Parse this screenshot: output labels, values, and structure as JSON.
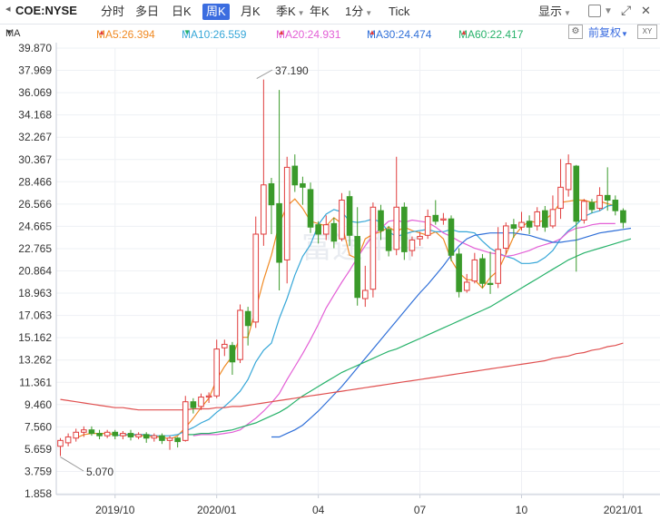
{
  "toolbar": {
    "symbol": "COE:NYSE",
    "timeframes": [
      {
        "label": "分时",
        "active": false,
        "caret": false
      },
      {
        "label": "多日",
        "active": false,
        "caret": false
      },
      {
        "label": "日K",
        "active": false,
        "caret": false
      },
      {
        "label": "周K",
        "active": true,
        "caret": false
      },
      {
        "label": "月K",
        "active": false,
        "caret": false
      },
      {
        "label": "季K",
        "active": false,
        "caret": true
      },
      {
        "label": "年K",
        "active": false,
        "caret": false
      },
      {
        "label": "1分",
        "active": false,
        "caret": true
      },
      {
        "label": "Tick",
        "active": false,
        "caret": false
      }
    ],
    "display_label": "显示",
    "adjust_label": "前复权",
    "ma_label": "MA"
  },
  "ma_indicators": [
    {
      "label": "MA5:26.394",
      "color": "#f08a24",
      "trend": "▲"
    },
    {
      "label": "MA10:26.559",
      "color": "#37a7d8",
      "trend": "▼"
    },
    {
      "label": "MA20:24.931",
      "color": "#e35fd6",
      "trend": "▲"
    },
    {
      "label": "MA30:24.474",
      "color": "#2f6fd8",
      "trend": "▲"
    },
    {
      "label": "MA60:22.417",
      "color": "#27b26a",
      "trend": "▲"
    }
  ],
  "colors": {
    "up": "#e03c3c",
    "down": "#3a9a2a",
    "ma120": "#e05050"
  },
  "chart_data": {
    "type": "candlestick",
    "y_ticks": [
      "39.870",
      "37.969",
      "36.069",
      "34.168",
      "32.267",
      "30.367",
      "28.466",
      "26.566",
      "24.665",
      "22.765",
      "20.864",
      "18.963",
      "17.063",
      "15.162",
      "13.262",
      "11.361",
      "9.460",
      "7.560",
      "5.659",
      "3.759",
      "1.858"
    ],
    "ylim": [
      1.858,
      39.87
    ],
    "x_labels": [
      {
        "label": "2019/10",
        "i": 7
      },
      {
        "label": "2020/01",
        "i": 20
      },
      {
        "label": "04",
        "i": 33
      },
      {
        "label": "07",
        "i": 46
      },
      {
        "label": "10",
        "i": 59
      },
      {
        "label": "2021/01",
        "i": 72
      }
    ],
    "annotations": [
      {
        "label": "37.190",
        "i": 25,
        "value": 37.19
      },
      {
        "label": "5.070",
        "i": 0,
        "value": 5.07
      }
    ],
    "candles": [
      [
        5.9,
        6.4,
        5.07,
        6.6
      ],
      [
        6.2,
        6.7,
        5.9,
        7.0
      ],
      [
        6.6,
        7.1,
        6.3,
        7.4
      ],
      [
        7.1,
        7.3,
        6.7,
        7.6
      ],
      [
        7.3,
        7.0,
        6.8,
        7.6
      ],
      [
        7.0,
        6.8,
        6.5,
        7.3
      ],
      [
        6.8,
        7.1,
        6.6,
        7.3
      ],
      [
        7.1,
        6.8,
        6.5,
        7.3
      ],
      [
        6.8,
        7.0,
        6.5,
        7.2
      ],
      [
        7.0,
        6.7,
        6.4,
        7.3
      ],
      [
        6.7,
        6.9,
        6.5,
        7.1
      ],
      [
        6.9,
        6.6,
        6.2,
        7.1
      ],
      [
        6.6,
        6.8,
        6.3,
        7.0
      ],
      [
        6.8,
        6.4,
        6.1,
        7.0
      ],
      [
        6.4,
        6.6,
        5.6,
        6.8
      ],
      [
        6.6,
        6.3,
        5.8,
        6.7
      ],
      [
        6.4,
        9.7,
        6.3,
        10.2
      ],
      [
        9.7,
        9.2,
        8.7,
        10.0
      ],
      [
        9.3,
        10.1,
        9.0,
        10.4
      ],
      [
        10.1,
        10.2,
        9.6,
        10.5
      ],
      [
        10.2,
        14.2,
        10.0,
        15.0
      ],
      [
        14.3,
        14.6,
        13.6,
        15.0
      ],
      [
        14.5,
        13.1,
        12.0,
        14.8
      ],
      [
        13.3,
        17.5,
        13.0,
        18.0
      ],
      [
        17.4,
        16.2,
        14.5,
        17.8
      ],
      [
        16.5,
        24.0,
        16.0,
        25.5
      ],
      [
        24.0,
        28.2,
        23.0,
        37.19
      ],
      [
        28.3,
        26.5,
        24.0,
        28.8
      ],
      [
        26.6,
        21.6,
        19.2,
        36.3
      ],
      [
        21.8,
        29.7,
        19.8,
        30.6
      ],
      [
        29.8,
        28.2,
        27.6,
        30.8
      ],
      [
        28.3,
        28.0,
        26.5,
        28.9
      ],
      [
        27.8,
        24.6,
        24.1,
        28.4
      ],
      [
        24.8,
        24.0,
        23.2,
        25.1
      ],
      [
        24.0,
        24.8,
        23.5,
        25.6
      ],
      [
        24.9,
        23.4,
        22.8,
        25.4
      ],
      [
        23.6,
        26.9,
        23.4,
        27.5
      ],
      [
        27.2,
        23.9,
        23.0,
        27.7
      ],
      [
        23.8,
        18.6,
        17.9,
        26.3
      ],
      [
        18.5,
        19.2,
        17.8,
        21.3
      ],
      [
        19.3,
        26.3,
        18.6,
        26.7
      ],
      [
        26.0,
        24.3,
        23.5,
        26.5
      ],
      [
        24.4,
        22.6,
        22.1,
        24.7
      ],
      [
        22.7,
        26.3,
        22.2,
        30.6
      ],
      [
        26.3,
        22.5,
        21.8,
        26.7
      ],
      [
        22.6,
        23.5,
        22.1,
        23.8
      ],
      [
        23.6,
        23.8,
        23.0,
        24.2
      ],
      [
        23.9,
        25.5,
        23.6,
        26.1
      ],
      [
        25.6,
        25.1,
        24.8,
        26.9
      ],
      [
        25.2,
        25.3,
        24.8,
        25.8
      ],
      [
        25.3,
        22.2,
        21.7,
        25.6
      ],
      [
        22.3,
        19.1,
        18.6,
        22.8
      ],
      [
        19.2,
        19.9,
        19.0,
        20.6
      ],
      [
        20.0,
        21.8,
        19.8,
        22.4
      ],
      [
        21.9,
        19.8,
        19.4,
        22.3
      ],
      [
        19.8,
        19.7,
        18.9,
        22.5
      ],
      [
        19.8,
        22.7,
        19.4,
        24.6
      ],
      [
        22.8,
        24.7,
        22.3,
        25.0
      ],
      [
        24.8,
        24.5,
        23.7,
        25.3
      ],
      [
        24.6,
        25.0,
        24.3,
        25.9
      ],
      [
        25.1,
        24.6,
        24.0,
        25.6
      ],
      [
        24.7,
        25.9,
        24.3,
        26.3
      ],
      [
        26.0,
        24.6,
        24.2,
        26.4
      ],
      [
        24.7,
        26.1,
        24.5,
        27.3
      ],
      [
        26.2,
        28.0,
        25.3,
        30.4
      ],
      [
        27.8,
        30.0,
        27.2,
        30.8
      ],
      [
        29.8,
        25.1,
        20.8,
        29.9
      ],
      [
        25.2,
        26.8,
        24.9,
        27.0
      ],
      [
        26.7,
        26.1,
        25.8,
        27.0
      ],
      [
        26.2,
        27.3,
        26.0,
        28.0
      ],
      [
        27.3,
        26.9,
        26.0,
        29.7
      ],
      [
        26.9,
        26.0,
        25.6,
        27.3
      ],
      [
        26.0,
        25.0,
        24.5,
        26.2
      ]
    ],
    "moving_averages": [
      {
        "name": "MA5",
        "color": "#f08a24",
        "start": 2,
        "values": [
          6.6,
          6.9,
          7.0,
          7.0,
          7.0,
          6.9,
          6.8,
          6.9,
          6.8,
          6.8,
          6.7,
          6.7,
          6.5,
          6.8,
          7.5,
          8.3,
          9.2,
          10.0,
          11.6,
          12.7,
          13.6,
          15.2,
          15.2,
          17.6,
          20.1,
          22.2,
          24.9,
          26.4,
          27.0,
          26.2,
          25.1,
          24.9,
          24.7,
          25.4,
          24.9,
          22.2,
          21.9,
          23.6,
          24.0,
          24.2,
          24.6,
          24.2,
          24.6,
          24.3,
          24.1,
          23.9,
          24.2,
          23.6,
          21.8,
          20.7,
          20.1,
          20.1,
          19.4,
          20.3,
          20.9,
          22.3,
          23.8,
          24.6,
          25.1,
          25.0,
          25.2,
          25.8,
          26.7,
          26.8,
          26.9,
          26.9,
          26.7,
          26.8,
          26.6,
          26.4
        ]
      },
      {
        "name": "MA10",
        "color": "#37a7d8",
        "start": 7,
        "values": [
          6.8,
          6.9,
          6.9,
          6.9,
          6.9,
          6.8,
          6.8,
          6.8,
          6.9,
          7.2,
          7.5,
          7.9,
          8.2,
          8.8,
          9.3,
          9.9,
          10.6,
          11.6,
          13.1,
          14.1,
          14.7,
          16.8,
          18.5,
          20.5,
          22.1,
          23.1,
          24.8,
          25.7,
          26.1,
          25.9,
          25.1,
          25.0,
          25.1,
          25.3,
          25.0,
          24.2,
          23.8,
          24.0,
          24.2,
          24.3,
          24.4,
          24.2,
          24.2,
          24.4,
          24.2,
          24.2,
          24.1,
          23.4,
          22.8,
          22.4,
          22.1,
          21.9,
          21.5,
          21.5,
          21.6,
          22.0,
          22.6,
          23.6,
          24.3,
          24.8,
          25.5,
          25.8,
          26.0,
          26.4,
          26.5
        ]
      },
      {
        "name": "MA20",
        "color": "#e35fd6",
        "start": 17,
        "values": [
          6.8,
          6.9,
          6.9,
          6.9,
          7.0,
          7.1,
          7.3,
          7.8,
          8.3,
          8.9,
          9.6,
          10.4,
          11.6,
          12.7,
          13.8,
          15.0,
          16.3,
          17.7,
          18.8,
          19.9,
          20.9,
          22.0,
          23.0,
          23.9,
          24.5,
          25.1,
          25.2,
          25.0,
          25.2,
          25.1,
          25.0,
          24.6,
          24.1,
          23.8,
          23.4,
          23.1,
          22.8,
          22.6,
          22.4,
          22.3,
          22.1,
          22.2,
          22.4,
          22.6,
          22.9,
          23.1,
          23.3,
          23.6,
          24.2,
          24.5,
          24.6,
          24.8,
          24.9,
          24.9,
          24.9
        ]
      },
      {
        "name": "MA30",
        "color": "#2f6fd8",
        "start": 27,
        "values": [
          6.7,
          6.7,
          7.0,
          7.3,
          7.7,
          8.3,
          8.9,
          9.6,
          10.3,
          11.0,
          11.8,
          12.6,
          13.4,
          14.2,
          15.0,
          15.8,
          16.6,
          17.4,
          18.2,
          19.0,
          19.7,
          20.5,
          21.3,
          22.2,
          23.0,
          23.6,
          23.9,
          24.0,
          24.1,
          24.1,
          24.1,
          24.1,
          24.0,
          23.9,
          23.7,
          23.5,
          23.3,
          23.3,
          23.4,
          23.5,
          23.7,
          23.9,
          24.1,
          24.2,
          24.3,
          24.4,
          24.5
        ]
      },
      {
        "name": "MA60",
        "color": "#27b26a",
        "start": 16,
        "values": [
          6.9,
          6.9,
          7.0,
          7.0,
          7.1,
          7.2,
          7.3,
          7.5,
          7.7,
          7.9,
          8.2,
          8.5,
          8.8,
          9.2,
          9.7,
          10.2,
          10.6,
          11.0,
          11.4,
          11.8,
          12.2,
          12.5,
          12.8,
          13.1,
          13.4,
          13.7,
          14.0,
          14.2,
          14.5,
          14.8,
          15.1,
          15.4,
          15.7,
          16.0,
          16.3,
          16.6,
          16.9,
          17.2,
          17.5,
          17.8,
          18.2,
          18.6,
          19.0,
          19.4,
          19.8,
          20.2,
          20.6,
          21.0,
          21.4,
          21.8,
          22.1,
          22.4,
          22.6,
          22.8,
          23.0,
          23.2,
          23.4,
          23.6
        ]
      },
      {
        "name": "MA120",
        "color": "#e05050",
        "start": 0,
        "values": [
          9.9,
          9.8,
          9.7,
          9.6,
          9.5,
          9.4,
          9.3,
          9.2,
          9.2,
          9.1,
          9.0,
          9.0,
          9.0,
          9.0,
          9.0,
          9.0,
          9.0,
          9.1,
          9.1,
          9.1,
          9.2,
          9.2,
          9.3,
          9.3,
          9.4,
          9.5,
          9.6,
          9.7,
          9.8,
          9.9,
          10.0,
          10.1,
          10.2,
          10.3,
          10.4,
          10.5,
          10.6,
          10.7,
          10.8,
          10.9,
          11.0,
          11.1,
          11.2,
          11.3,
          11.4,
          11.5,
          11.6,
          11.7,
          11.8,
          11.9,
          12.0,
          12.1,
          12.2,
          12.3,
          12.4,
          12.5,
          12.6,
          12.7,
          12.8,
          12.9,
          13.0,
          13.1,
          13.2,
          13.4,
          13.5,
          13.6,
          13.8,
          13.9,
          14.1,
          14.2,
          14.4,
          14.5,
          14.7
        ]
      }
    ],
    "watermark": "富途牛牛"
  }
}
